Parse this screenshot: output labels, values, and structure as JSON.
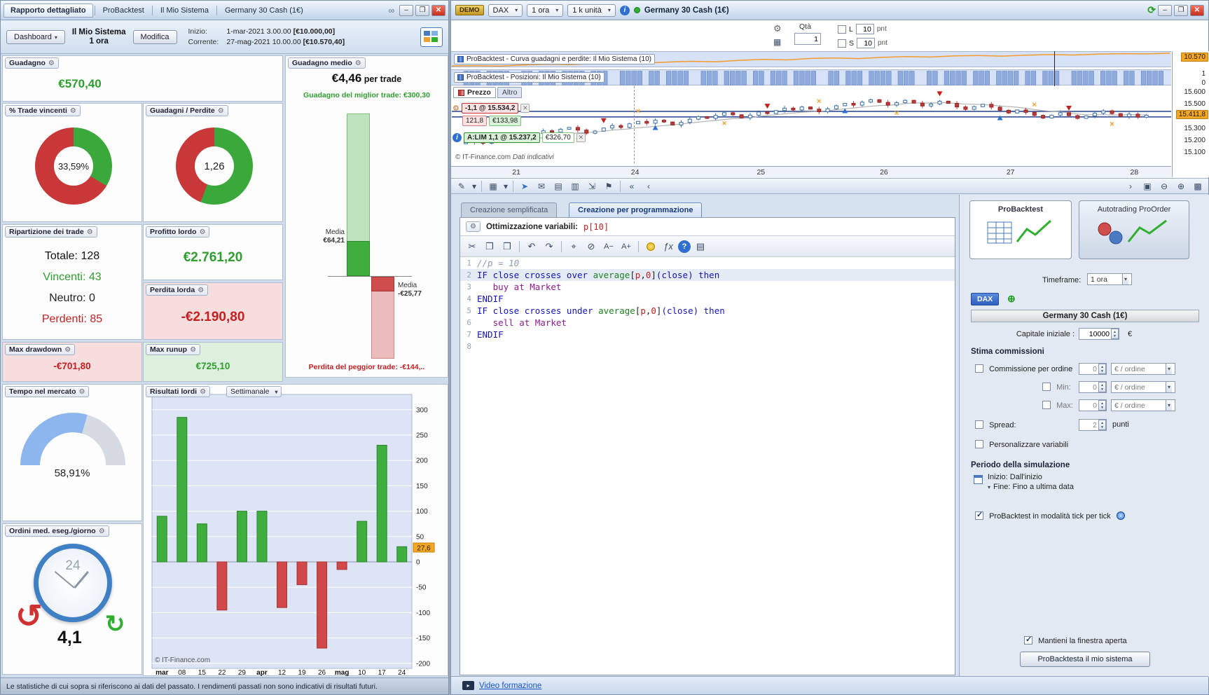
{
  "colors": {
    "green": "#2f9e2f",
    "red": "#c42020",
    "orange": "#f5a623",
    "blue": "#3a6fd0",
    "equity_curve": "#f39b2d",
    "bar_green": "#3fae3f",
    "bar_red": "#d04848"
  },
  "icons": {
    "wrench": "⚙",
    "gear": "⚙",
    "cut": "✂",
    "copy": "❐",
    "paste": "❒",
    "undo": "↶",
    "redo": "↷",
    "search": "⌖",
    "comment": "⊘",
    "font_minus": "A−",
    "font_plus": "A+",
    "fx": "ƒx",
    "help": "?",
    "print": "▤",
    "draw": "✎",
    "style": "▦",
    "share": "➤",
    "chat": "✉",
    "table": "▤",
    "columns": "▥",
    "export": "⇲",
    "flag": "⚑",
    "left2": "«",
    "left": "‹",
    "right": "›",
    "fit": "▣",
    "zoom_out": "⊖",
    "zoom_in": "⊕",
    "grid": "▩",
    "calc": "▦",
    "link": "∞",
    "minimize": "–",
    "maximize": "❐",
    "close": "✕",
    "caret": "▾",
    "plus": "⊕",
    "play": "▸",
    "info": "i",
    "sync": "⟳",
    "x": "✕",
    "up_spin": "▲",
    "down_spin": "▼"
  },
  "left": {
    "tabs": [
      "Rapporto dettagliato",
      "ProBacktest",
      "Il Mio Sistema",
      "Germany 30 Cash (1€)"
    ],
    "header": {
      "dashboard": "Dashboard",
      "system": "Il Mio Sistema",
      "timeframe": "1 ora",
      "modifica": "Modifica",
      "inizio_label": "Inizio:",
      "inizio": "1-mar-2021 3.00.00",
      "inizio_cap": "[€10.000,00]",
      "corrente_label": "Corrente:",
      "corrente": "27-mag-2021 10.00.00",
      "corrente_cap": "[€10.570,40]"
    },
    "guadagno": {
      "title": "Guadagno",
      "value": "€570,40"
    },
    "pct_vincenti": {
      "title": "% Trade vincenti",
      "label": "33,59%",
      "pct": 33.59
    },
    "gp_ratio": {
      "title": "Guadagni / Perdite",
      "label": "1,26",
      "pct": 55.8
    },
    "gmedio": {
      "title": "Guadagno medio",
      "big": "€4,46",
      "suffix": " per trade",
      "best": "Guadagno del miglior trade: €300,30",
      "media_win_l1": "Media",
      "media_win_l2": "€64,21",
      "media_loss_l1": "Media",
      "media_loss_l2": "-€25,77",
      "worst": "Perdita del peggior trade: -€144,.."
    },
    "ripartizione": {
      "title": "Ripartizione dei trade",
      "totale": "Totale: 128",
      "vincenti": "Vincenti: 43",
      "neutro": "Neutro: 0",
      "perdenti": "Perdenti: 85"
    },
    "profitto": {
      "title": "Profitto lordo",
      "value": "€2.761,20"
    },
    "perdita": {
      "title": "Perdita lorda",
      "value": "-€2.190,80"
    },
    "drawdown": {
      "title": "Max drawdown",
      "value": "-€701,80"
    },
    "runup": {
      "title": "Max runup",
      "value": "€725,10"
    },
    "tempo": {
      "title": "Tempo nel mercato",
      "value": "58,91%",
      "pct": 58.91
    },
    "ordini": {
      "title": "Ordini med. eseg./giorno",
      "value": "4,1",
      "clock": "24"
    },
    "risultati": {
      "title": "Risultati lordi",
      "period": "Settimanale",
      "copyright": "© IT-Finance.com",
      "current_label": "27,6"
    },
    "footer": "Le statistiche di cui sopra si riferiscono ai dati del passato. I rendimenti passati non sono indicativi di risultati futuri."
  },
  "chart_data": {
    "type": "bar",
    "title": "Risultati lordi (Settimanale)",
    "categories": [
      "mar",
      "08",
      "15",
      "22",
      "29",
      "apr",
      "12",
      "19",
      "26",
      "mag",
      "10",
      "17",
      "24"
    ],
    "bold_categories": [
      0,
      5,
      9
    ],
    "values": [
      90,
      285,
      75,
      -95,
      100,
      100,
      -90,
      -45,
      -170,
      -15,
      80,
      230,
      30
    ],
    "ylim": [
      -200,
      300
    ],
    "ytick_step": 50,
    "current": 27.6,
    "current_label": "27,6",
    "xlabel": "",
    "ylabel": "",
    "legend": false
  },
  "right": {
    "titlebar": {
      "demo": "DEMO",
      "symbol": "DAX",
      "tf": "1 ora",
      "units": "1 k unità",
      "instrument": "Germany 30 Cash (1€)"
    },
    "controls": {
      "qta": "Qtà",
      "qta_value": "1",
      "l": "L",
      "s": "S",
      "l_val": "10",
      "s_val": "10",
      "pnt": "pnt"
    },
    "equity_row": {
      "label": "ProBacktest - Curva guadagni e perdite: Il Mio Sistema (10)",
      "last": "10.570"
    },
    "pos_row": {
      "label": "ProBacktest - Posizioni: Il Mio Sistema (10)",
      "hi": "1",
      "lo": "0"
    },
    "price_row": {
      "tab1": "Prezzo",
      "tab2": "Altro",
      "scale": [
        {
          "label": "15.600",
          "price": 15600
        },
        {
          "label": "15.500",
          "price": 15500
        },
        {
          "label": "15.300",
          "price": 15300
        },
        {
          "label": "15.200",
          "price": 15200
        },
        {
          "label": "15.100",
          "price": 15100
        }
      ],
      "last": "15.411,8",
      "last_price": 15411.8,
      "pos_tag": "-1,1 @ 15.534,2",
      "pos_pts": "121,8",
      "pos_eur": "€133,98",
      "lim_tag": "A:LIM  1,1 @ 15.237,2",
      "lim_eur": "€326,70",
      "copyright": "© IT-Finance.com",
      "indicativi": "Dati indicativi",
      "xticks": [
        "21",
        "24",
        "25",
        "26",
        "27",
        "28"
      ],
      "xtick_pos": [
        0.085,
        0.25,
        0.425,
        0.596,
        0.772,
        0.944
      ]
    },
    "editor": {
      "tab_simple": "Creazione semplificata",
      "tab_prog": "Creazione per programmazione",
      "opt_label": "Ottimizzazione variabili:",
      "opt_var": "p",
      "opt_val": "[10]"
    },
    "settings": {
      "tab1": "ProBacktest",
      "tab2": "Autotrading ProOrder",
      "timeframe_label": "Timeframe:",
      "timeframe": "1 ora",
      "symbol_chip": "DAX",
      "instrument": "Germany 30 Cash (1€)",
      "capitale_label": "Capitale iniziale :",
      "capitale": "10000",
      "eur": "€",
      "stima": "Stima commissioni",
      "comm_label": "Commissione per ordine",
      "comm_val": "0",
      "min_label": "Min:",
      "min_val": "0",
      "max_label": "Max:",
      "max_val": "0",
      "per_ordine": "€ / ordine",
      "spread_label": "Spread:",
      "spread_val": "2",
      "punti": "punti",
      "perso": "Personalizzare variabili",
      "periodo": "Periodo della simulazione",
      "inizio": "Inizio: Dall'inizio",
      "fine": "Fine: Fino a ultima data",
      "tick": "ProBacktest in modalità tick per tick",
      "mantieni": "Mantieni la finestra aperta",
      "backtest_btn": "ProBacktesta il mio sistema"
    },
    "bottombar": {
      "video": "Video formazione"
    }
  },
  "series": {
    "equity": [
      10000,
      10005,
      9995,
      10040,
      10070,
      10055,
      10110,
      10140,
      10125,
      10170,
      10205,
      10185,
      10250,
      10290,
      10270,
      10335,
      10355,
      10330,
      10385,
      10420,
      10400,
      10450,
      10470,
      10440,
      10480,
      10510,
      10490,
      10530,
      10550,
      10540,
      10570
    ],
    "positions": "0011101111001101110111101110011110110111100111011110110111011110011011101111011100110111101110111101101110011110111011011110",
    "closes": [
      15185,
      15200,
      15178,
      15210,
      15235,
      15222,
      15248,
      15230,
      15260,
      15282,
      15270,
      15295,
      15310,
      15288,
      15262,
      15280,
      15305,
      15325,
      15310,
      15340,
      15360,
      15345,
      15370,
      15355,
      15330,
      15352,
      15378,
      15400,
      15385,
      15410,
      15432,
      15415,
      15390,
      15412,
      15438,
      15425,
      15450,
      15470,
      15455,
      15480,
      15462,
      15440,
      15465,
      15490,
      15510,
      15495,
      15520,
      15540,
      15518,
      15495,
      15515,
      15535,
      15512,
      15488,
      15505,
      15528,
      15510,
      15480,
      15460,
      15482,
      15502,
      15478,
      15452,
      15430,
      15455,
      15435,
      15410,
      15388,
      15412,
      15432,
      15408,
      15385,
      15405,
      15428,
      15448,
      15425,
      15400,
      15420,
      15395,
      15412
    ],
    "markers": {
      "up": [
        10,
        22,
        44,
        62
      ],
      "down": [
        16,
        35,
        55,
        70
      ],
      "x": [
        13,
        20,
        30,
        41,
        50,
        66,
        75
      ]
    },
    "order_lines": [
      15443,
      15397
    ]
  },
  "code": {
    "lines": [
      {
        "n": 1,
        "tokens": [
          [
            "cmt",
            "//p = 10"
          ]
        ]
      },
      {
        "n": 2,
        "active": true,
        "tokens": [
          [
            "kw",
            "IF close crosses over "
          ],
          [
            "fn",
            "average"
          ],
          [
            "pl",
            "["
          ],
          [
            "var",
            "p"
          ],
          [
            "pl",
            ","
          ],
          [
            "num",
            "0"
          ],
          [
            "pl",
            "]"
          ],
          [
            "kw",
            "(close) then"
          ]
        ]
      },
      {
        "n": 3,
        "tokens": [
          [
            "pl",
            "   "
          ],
          [
            "stmt",
            "buy at Market"
          ]
        ]
      },
      {
        "n": 4,
        "tokens": [
          [
            "kw",
            "ENDIF"
          ]
        ]
      },
      {
        "n": 5,
        "tokens": [
          [
            "kw",
            "IF close crosses under "
          ],
          [
            "fn",
            "average"
          ],
          [
            "pl",
            "["
          ],
          [
            "var",
            "p"
          ],
          [
            "pl",
            ","
          ],
          [
            "num",
            "0"
          ],
          [
            "pl",
            "]"
          ],
          [
            "kw",
            "(close) then"
          ]
        ]
      },
      {
        "n": 6,
        "tokens": [
          [
            "pl",
            "   "
          ],
          [
            "stmt",
            "sell at Market"
          ]
        ]
      },
      {
        "n": 7,
        "tokens": [
          [
            "kw",
            "ENDIF"
          ]
        ]
      },
      {
        "n": 8,
        "tokens": []
      }
    ]
  }
}
